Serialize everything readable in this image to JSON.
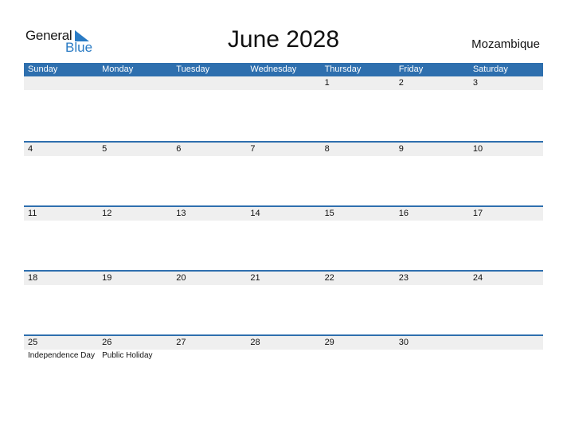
{
  "logo": {
    "line1": "General",
    "line2": "Blue"
  },
  "title": "June 2028",
  "country": "Mozambique",
  "colors": {
    "header_bg": "#2e6fae",
    "day_strip_bg": "#efefef",
    "brand_blue": "#2a7bc4"
  },
  "weekdays": [
    "Sunday",
    "Monday",
    "Tuesday",
    "Wednesday",
    "Thursday",
    "Friday",
    "Saturday"
  ],
  "weeks": [
    {
      "days": [
        "",
        "",
        "",
        "",
        "1",
        "2",
        "3"
      ],
      "holidays": [
        "",
        "",
        "",
        "",
        "",
        "",
        ""
      ]
    },
    {
      "days": [
        "4",
        "5",
        "6",
        "7",
        "8",
        "9",
        "10"
      ],
      "holidays": [
        "",
        "",
        "",
        "",
        "",
        "",
        ""
      ]
    },
    {
      "days": [
        "11",
        "12",
        "13",
        "14",
        "15",
        "16",
        "17"
      ],
      "holidays": [
        "",
        "",
        "",
        "",
        "",
        "",
        ""
      ]
    },
    {
      "days": [
        "18",
        "19",
        "20",
        "21",
        "22",
        "23",
        "24"
      ],
      "holidays": [
        "",
        "",
        "",
        "",
        "",
        "",
        ""
      ]
    },
    {
      "days": [
        "25",
        "26",
        "27",
        "28",
        "29",
        "30",
        ""
      ],
      "holidays": [
        "Independence Day",
        "Public Holiday",
        "",
        "",
        "",
        "",
        ""
      ]
    }
  ]
}
